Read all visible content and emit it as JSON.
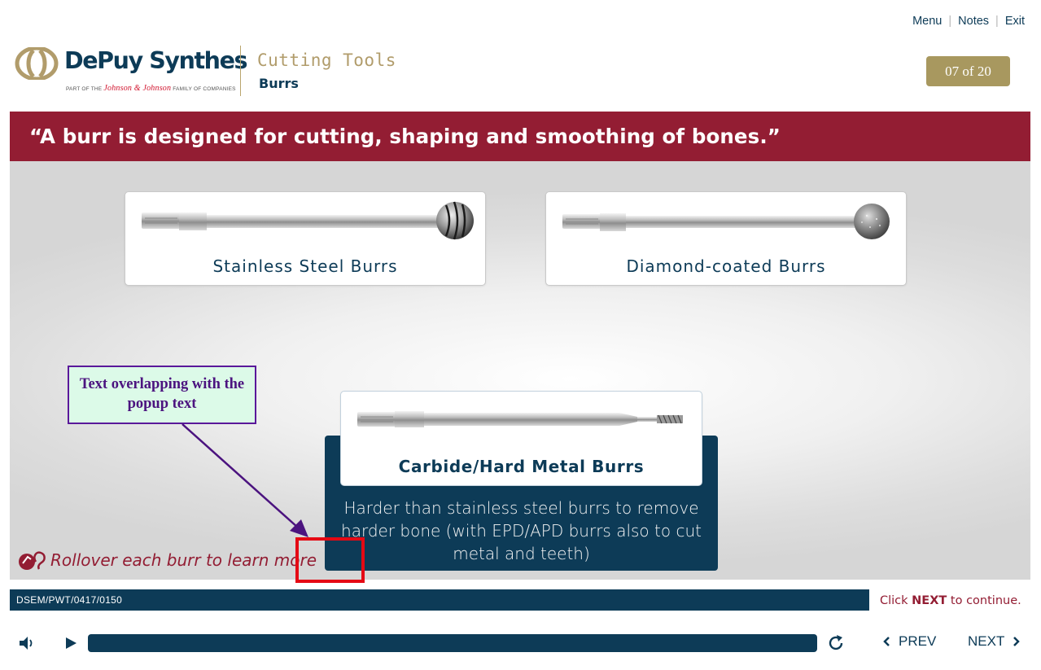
{
  "topnav": {
    "menu": "Menu",
    "notes": "Notes",
    "exit": "Exit"
  },
  "logo": {
    "name": "DePuy Synthes",
    "tag_prefix": "PART OF THE",
    "tag_brand": "Johnson & Johnson",
    "tag_suffix": "FAMILY OF COMPANIES"
  },
  "header": {
    "title": "Cutting Tools",
    "subtitle": "Burrs",
    "page_counter": "07 of 20"
  },
  "banner": {
    "quote": "“A burr is designed for cutting, shaping and smoothing of bones.”"
  },
  "burrs": [
    {
      "label": "Stainless Steel Burrs"
    },
    {
      "label": "Diamond-coated Burrs"
    },
    {
      "label": "Carbide/Hard Metal Burrs",
      "popup": "Harder than stainless steel burrs to remove harder bone (with EPD/APD burrs also to cut metal and teeth)"
    }
  ],
  "annotation": {
    "text": "Text overlapping with the popup text"
  },
  "instruction": {
    "text": "Rollover each burr to learn more"
  },
  "footer": {
    "code": "DSEM/PWT/0417/0150",
    "click_prefix": "Click",
    "click_next": "NEXT",
    "click_suffix": "to continue."
  },
  "controls": {
    "prev": "PREV",
    "next": "NEXT",
    "volume_icon": "speaker-icon",
    "play_icon": "play-icon",
    "replay_icon": "replay-icon"
  },
  "colors": {
    "navy": "#0d3b57",
    "crimson": "#931d33",
    "gold": "#a8985f",
    "annotation_purple": "#5a189a",
    "annotation_bg": "#dcfae8",
    "highlight_red": "#e50914"
  }
}
